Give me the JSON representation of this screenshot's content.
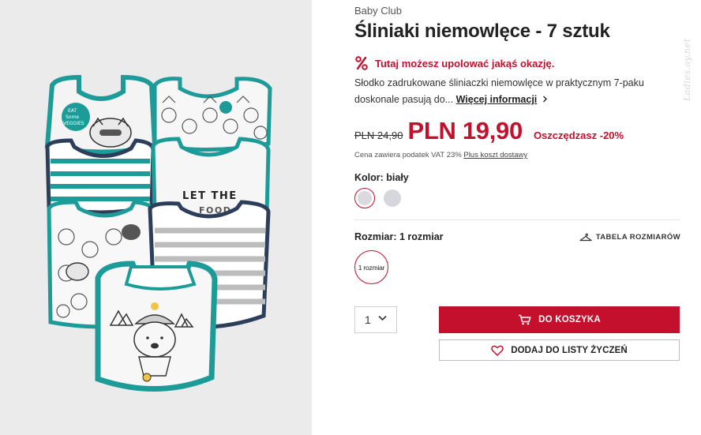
{
  "product": {
    "brand": "Baby Club",
    "title": "Śliniaki niemowlęce - 7 sztuk",
    "image_texts": [
      "EAT Some VEGGIES",
      "LET THE FOOD"
    ],
    "deal_icon": "percent-icon",
    "deal_text": "Tutaj możesz upolować jakąś okazję.",
    "description": "Słodko zadrukowane śliniaczki niemowlęce w praktycznym 7-paku doskonale pasują do...",
    "more_info_label": "Więcej informacji",
    "more_info_icon": "chevron-right-icon"
  },
  "price": {
    "old": "PLN 24,90",
    "current": "PLN 19,90",
    "saving": "Oszczędzasz -20%",
    "tax_note": "Cena zawiera podatek VAT 23%",
    "shipping_link": "Plus koszt dostawy",
    "accent_color": "#c4102c"
  },
  "color": {
    "label": "Kolor: biały",
    "swatches": [
      "#d9d9de",
      "#d6d6dd"
    ],
    "selected_index": 0
  },
  "size": {
    "label": "Rozmiar: 1 rozmiar",
    "table_label": "TABELA ROZMIARÓW",
    "table_icon": "hanger-icon",
    "options": [
      "1 rozmiar"
    ],
    "selected_index": 0
  },
  "purchase": {
    "quantity": "1",
    "quantity_icon": "chevron-down-icon",
    "cart_label": "DO KOSZYKA",
    "cart_icon": "cart-icon",
    "wishlist_label": "DODAJ DO LISTY ŻYCZEŃ",
    "wishlist_icon": "heart-icon"
  },
  "watermark": "Ladies.ay.net"
}
